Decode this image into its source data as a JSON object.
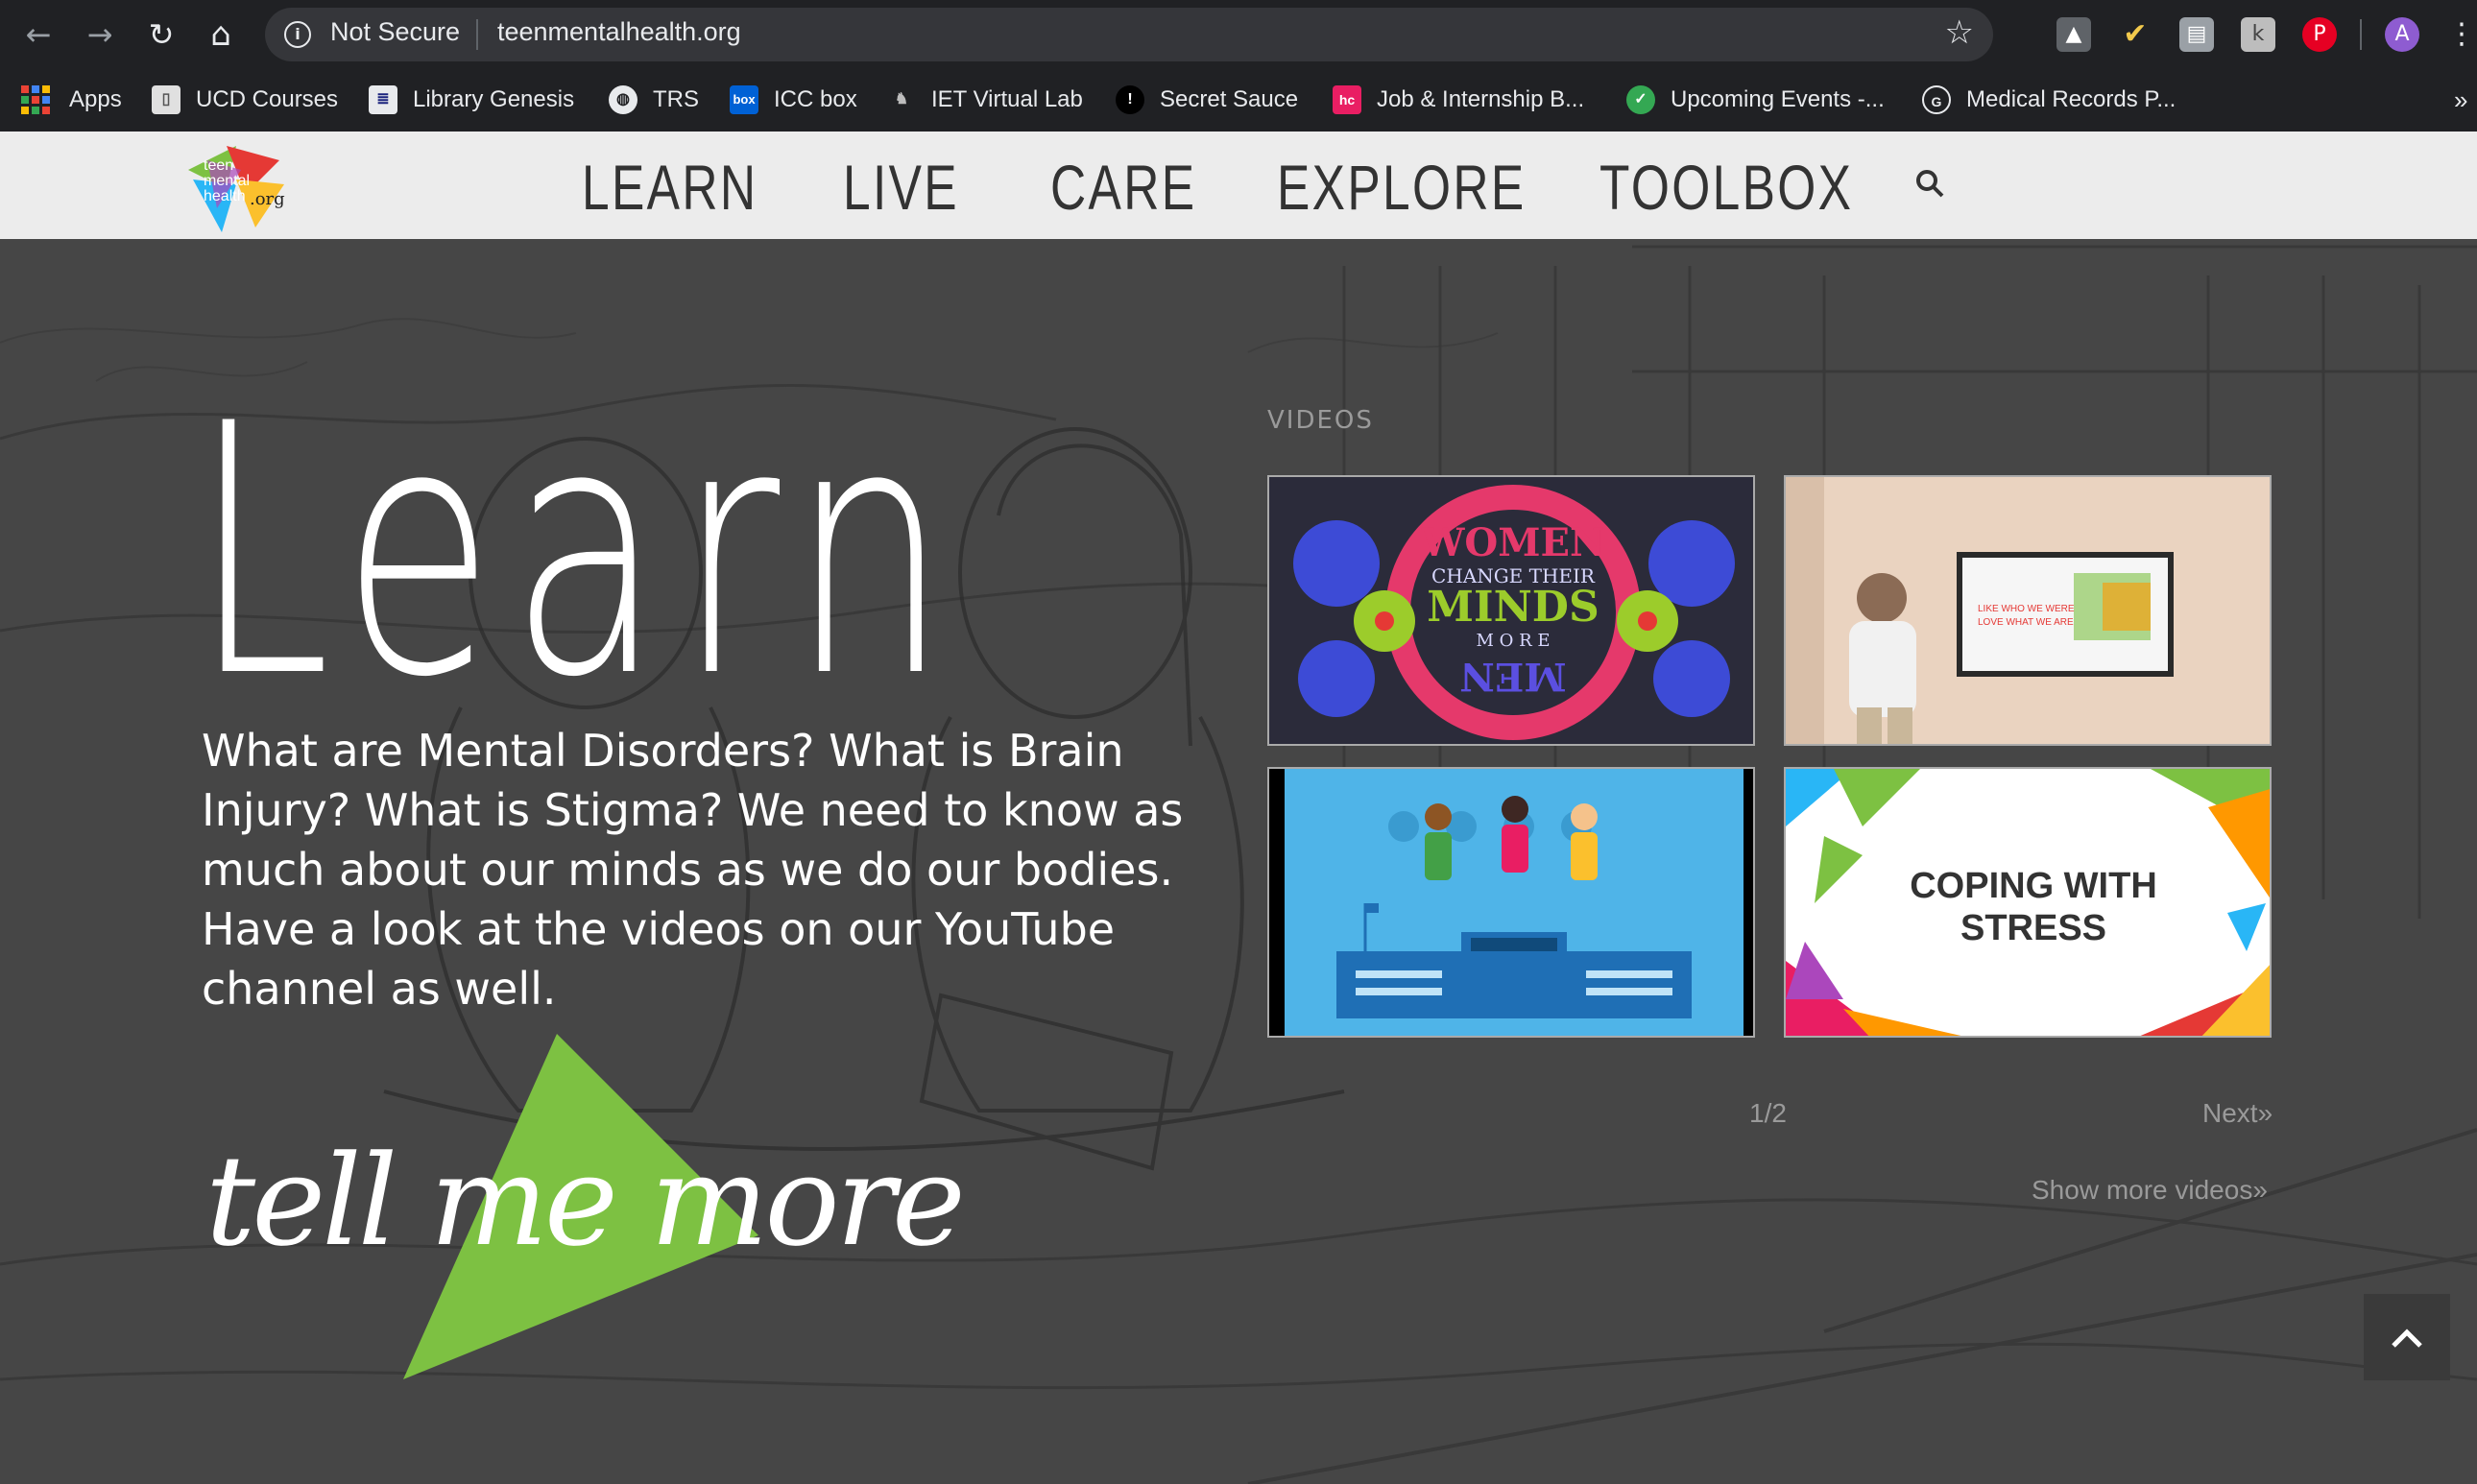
{
  "browser": {
    "security_label": "Not Secure",
    "url": "teenmentalhealth.org",
    "profile_initial": "A",
    "bookmarks": [
      {
        "label": "Apps"
      },
      {
        "label": "UCD Courses"
      },
      {
        "label": "Library Genesis"
      },
      {
        "label": "TRS"
      },
      {
        "label": "ICC box"
      },
      {
        "label": "IET Virtual Lab"
      },
      {
        "label": "Secret Sauce"
      },
      {
        "label": "Job & Internship B..."
      },
      {
        "label": "Upcoming Events -..."
      },
      {
        "label": "Medical Records P..."
      }
    ],
    "bookmark_icon_texts": {
      "icc": "box",
      "job": "hc"
    },
    "more_label": "»"
  },
  "site": {
    "logo_text": {
      "line1": "teen",
      "line2": "mental",
      "line3": "health",
      "line4": ".org"
    },
    "menu": [
      "LEARN",
      "LIVE",
      "CARE",
      "EXPLORE",
      "TOOLBOX"
    ]
  },
  "hero": {
    "title": "Learn",
    "body": "What are Mental Disorders? What is Brain Injury? What is Stigma? We need to know as much about our minds as we do our bodies. Have a look at the videos on our YouTube channel as well.",
    "cta": "tell me more"
  },
  "videos": {
    "label": "VIDEOS",
    "thumbs": [
      {
        "line1": "WOMEN",
        "line2": "CHANGE THEIR",
        "line3": "MINDS",
        "line4": "M O R E",
        "line5": "MEN"
      },
      {
        "screen_line1": "LIKE WHO WE WERE",
        "screen_line2": "LOVE WHAT WE ARE"
      },
      {},
      {
        "line1": "COPING WITH",
        "line2": "STRESS"
      }
    ],
    "page_indicator": "1/2",
    "next_label": "Next»",
    "show_more_label": "Show more videos»"
  },
  "colors": {
    "accent_green": "#7dc142",
    "browser_bg": "#202124",
    "menu_text": "#333333"
  }
}
